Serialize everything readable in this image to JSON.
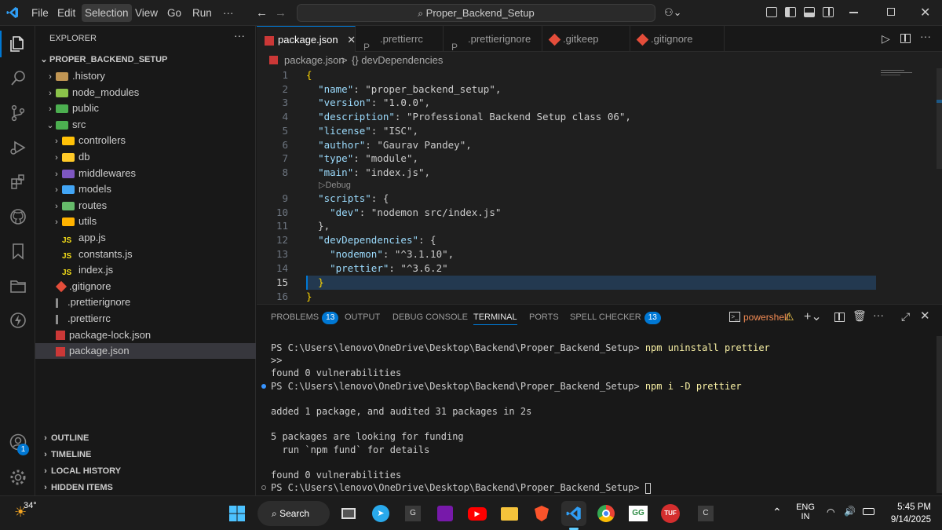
{
  "titlebar": {
    "menu": [
      "File",
      "Edit",
      "Selection",
      "View",
      "Go",
      "Run",
      "···"
    ],
    "search_text": "Proper_Backend_Setup"
  },
  "explorer": {
    "header": "EXPLORER",
    "root": "PROPER_BACKEND_SETUP",
    "items": [
      {
        "label": ".history",
        "icon": "folder-history-icon"
      },
      {
        "label": "node_modules",
        "icon": "folder-node-icon"
      },
      {
        "label": "public",
        "icon": "folder-public-icon"
      },
      {
        "label": "src",
        "icon": "folder-src-icon"
      },
      {
        "label": "controllers",
        "icon": "folder-controllers-icon"
      },
      {
        "label": "db",
        "icon": "folder-db-icon"
      },
      {
        "label": "middlewares",
        "icon": "folder-middlewares-icon"
      },
      {
        "label": "models",
        "icon": "folder-models-icon"
      },
      {
        "label": "routes",
        "icon": "folder-routes-icon"
      },
      {
        "label": "utils",
        "icon": "folder-utils-icon"
      },
      {
        "label": "app.js",
        "icon": "js-icon"
      },
      {
        "label": "constants.js",
        "icon": "js-icon"
      },
      {
        "label": "index.js",
        "icon": "js-icon"
      },
      {
        "label": ".gitignore",
        "icon": "git-icon"
      },
      {
        "label": ".prettierignore",
        "icon": "prettier-icon"
      },
      {
        "label": ".prettierrc",
        "icon": "prettier-icon"
      },
      {
        "label": "package-lock.json",
        "icon": "npm-icon"
      },
      {
        "label": "package.json",
        "icon": "npm-icon"
      }
    ],
    "js_glyph": "JS",
    "sections": [
      "OUTLINE",
      "TIMELINE",
      "LOCAL HISTORY",
      "HIDDEN ITEMS"
    ]
  },
  "tabs": [
    "package.json",
    ".prettierrc",
    ".prettierignore",
    ".gitkeep",
    ".gitignore"
  ],
  "breadcrumb": {
    "file": "package.json",
    "sep": ">",
    "node": "{} devDependencies"
  },
  "editor": {
    "line_numbers": [
      "1",
      "2",
      "3",
      "4",
      "5",
      "6",
      "7",
      "8",
      "9",
      "10",
      "11",
      "12",
      "13",
      "14",
      "15",
      "16"
    ],
    "lines": [
      "{",
      "  \"name\": \"proper_backend_setup\",",
      "  \"version\": \"1.0.0\",",
      "  \"description\": \"Professional Backend Setup class 06\",",
      "  \"license\": \"ISC\",",
      "  \"author\": \"Gaurav Pandey\",",
      "  \"type\": \"module\",",
      "  \"main\": \"index.js\",",
      "  \"scripts\": {",
      "    \"dev\": \"nodemon src/index.js\"",
      "  },",
      "  \"devDependencies\": {",
      "    \"nodemon\": \"^3.1.10\",",
      "    \"prettier\": \"^3.6.2\"",
      "  }",
      "}"
    ],
    "codelens": "Debug"
  },
  "panel": {
    "tabs": [
      "PROBLEMS",
      "OUTPUT",
      "DEBUG CONSOLE",
      "TERMINAL",
      "PORTS",
      "SPELL CHECKER"
    ],
    "problems_count": "13",
    "spell_count": "13",
    "shell": "powershell",
    "terminal": [
      {
        "prompt": "PS C:\\Users\\lenovo\\OneDrive\\Desktop\\Backend\\Proper_Backend_Setup> ",
        "cmd": "npm uninstall prettier"
      },
      {
        "text": ">>"
      },
      {
        "text": "found 0 vulnerabilities"
      },
      {
        "prompt": "PS C:\\Users\\lenovo\\OneDrive\\Desktop\\Backend\\Proper_Backend_Setup> ",
        "cmd": "npm i -D prettier"
      },
      {
        "text": ""
      },
      {
        "text": "added 1 package, and audited 31 packages in 2s"
      },
      {
        "text": ""
      },
      {
        "text": "5 packages are looking for funding"
      },
      {
        "text": "  run `npm fund` for details"
      },
      {
        "text": ""
      },
      {
        "text": "found 0 vulnerabilities"
      },
      {
        "prompt": "PS C:\\Users\\lenovo\\OneDrive\\Desktop\\Backend\\Proper_Backend_Setup> ",
        "cmd": ""
      }
    ]
  },
  "taskbar": {
    "weather": "34°",
    "search": "Search",
    "apps_labels": {
      "g": "G",
      "c": "C",
      "tuf": "TUF"
    },
    "lang": "ENG",
    "region": "IN",
    "time": "5:45 PM",
    "date": "9/14/2025"
  },
  "account_badge": "1",
  "colors": {
    "accent": "#0078d4",
    "bg": "#1f1f1f",
    "sidebar": "#181818"
  }
}
